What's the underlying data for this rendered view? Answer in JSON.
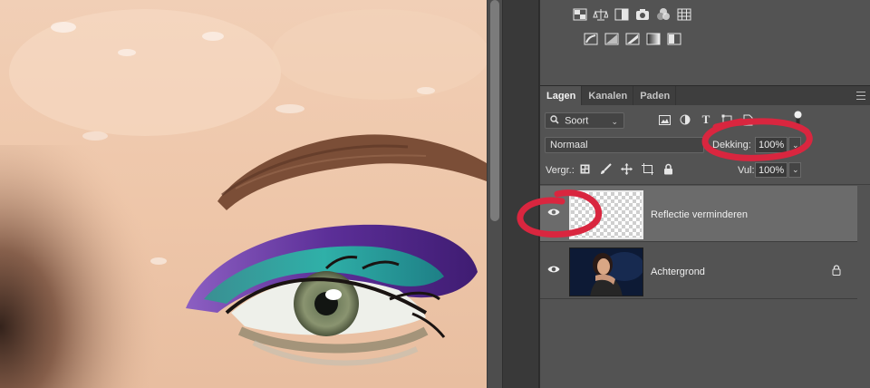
{
  "tabs": [
    {
      "label": "Lagen",
      "active": true
    },
    {
      "label": "Kanalen",
      "active": false
    },
    {
      "label": "Paden",
      "active": false
    }
  ],
  "filter": {
    "kind_label": "Soort"
  },
  "blend_mode": "Normaal",
  "opacity": {
    "label": "Dekking:",
    "value": "100%"
  },
  "lock": {
    "label": "Vergr.:"
  },
  "fill": {
    "label": "Vul:",
    "value": "100%"
  },
  "layers": [
    {
      "name": "Reflectie verminderen",
      "visible": true,
      "selected": true,
      "locked": false
    },
    {
      "name": "Achtergrond",
      "visible": true,
      "selected": false,
      "locked": true
    }
  ],
  "colors": {
    "annotation": "#d9263f",
    "panel_bg": "#535353",
    "selected_layer": "#6b6b6b"
  },
  "icons": {
    "adjustments_row1": [
      "brightness-contrast-icon",
      "levels-icon",
      "curves-icon",
      "exposure-icon",
      "vibrance-icon",
      "hue-saturation-icon"
    ],
    "adjustments_row2": [
      "invert-icon",
      "posterize-icon",
      "threshold-icon",
      "gradient-map-icon",
      "selective-color-icon"
    ],
    "filters": [
      "image-filter-icon",
      "adjustment-filter-icon",
      "type-filter-icon",
      "shape-filter-icon",
      "smart-object-filter-icon"
    ],
    "locks": [
      "lock-transparency-icon",
      "lock-pixels-icon",
      "lock-position-icon",
      "lock-artboard-icon",
      "lock-all-icon"
    ]
  }
}
